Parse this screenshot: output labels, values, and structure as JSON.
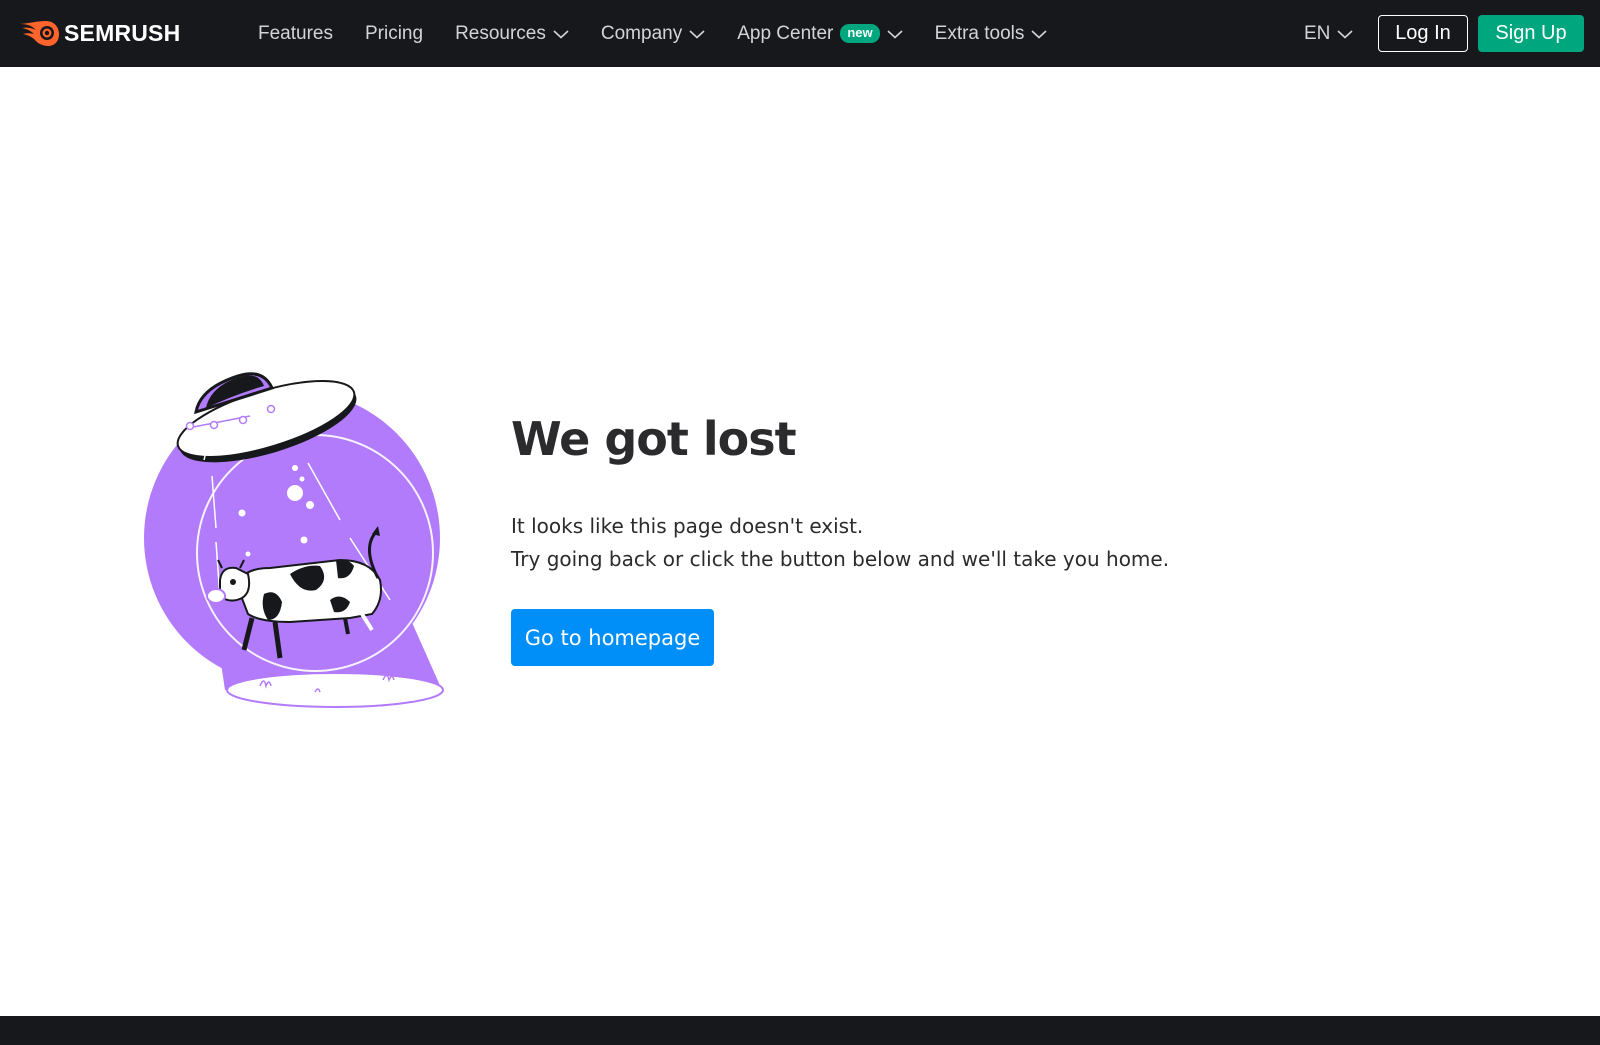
{
  "header": {
    "logo_text": "SEMRUSH",
    "nav": [
      {
        "label": "Features",
        "has_dropdown": false
      },
      {
        "label": "Pricing",
        "has_dropdown": false
      },
      {
        "label": "Resources",
        "has_dropdown": true
      },
      {
        "label": "Company",
        "has_dropdown": true
      },
      {
        "label": "App Center",
        "has_dropdown": true,
        "badge": "new"
      },
      {
        "label": "Extra tools",
        "has_dropdown": true
      }
    ],
    "language": "EN",
    "login_label": "Log In",
    "signup_label": "Sign Up"
  },
  "main": {
    "title": "We got lost",
    "desc_line1": "It looks like this page doesn't exist.",
    "desc_line2": "Try going back or click the button below and we'll take you home.",
    "home_button": "Go to homepage",
    "illustration_icon": "ufo-abducting-cow-icon"
  },
  "colors": {
    "header_bg": "#17181b",
    "brand_orange": "#ff642d",
    "accent_green": "#00a67e",
    "primary_blue": "#008ff8",
    "illustration_purple": "#b27bfb"
  }
}
